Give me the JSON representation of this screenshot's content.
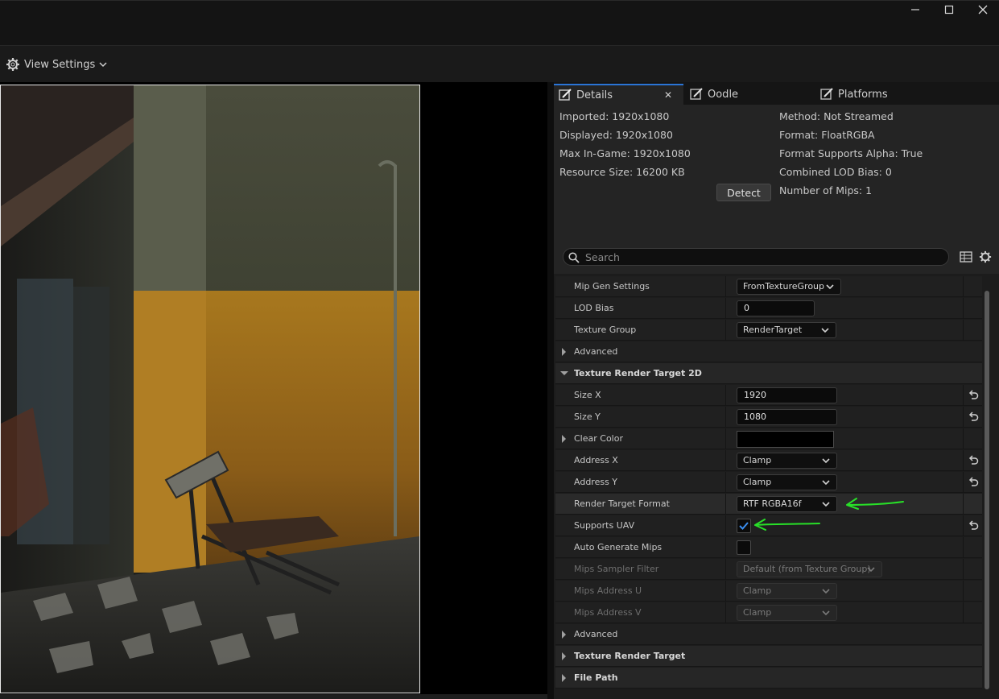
{
  "window": {
    "minimize": "—",
    "maximize": "☐",
    "close": "✕"
  },
  "toolbar": {
    "view_settings_label": "View Settings",
    "view_settings_icon": "gear-icon"
  },
  "tabs": [
    {
      "label": "Details",
      "icon": "pencil-icon",
      "active": true,
      "close": "✕"
    },
    {
      "label": "Oodle",
      "icon": "pencil-icon",
      "active": false
    },
    {
      "label": "Platforms",
      "icon": "pencil-icon",
      "active": false
    }
  ],
  "info": {
    "left": [
      "Imported: 1920x1080",
      "Displayed: 1920x1080",
      "Max In-Game: 1920x1080",
      "Resource Size: 16200 KB"
    ],
    "right": [
      "Method: Not Streamed",
      "Format: FloatRGBA",
      "Format Supports Alpha: True",
      "Combined LOD Bias: 0",
      "Number of Mips: 1"
    ],
    "detect_label": "Detect"
  },
  "search": {
    "placeholder": "Search",
    "value": ""
  },
  "properties": {
    "mip_gen_settings": {
      "label": "Mip Gen Settings",
      "value": "FromTextureGroup"
    },
    "lod_bias": {
      "label": "LOD Bias",
      "value": "0"
    },
    "texture_group": {
      "label": "Texture Group",
      "value": "RenderTarget"
    },
    "advanced_1": {
      "label": "Advanced"
    },
    "category_rt2d": {
      "label": "Texture Render Target 2D"
    },
    "size_x": {
      "label": "Size X",
      "value": "1920"
    },
    "size_y": {
      "label": "Size Y",
      "value": "1080"
    },
    "clear_color": {
      "label": "Clear Color",
      "value": "#000000"
    },
    "address_x": {
      "label": "Address X",
      "value": "Clamp"
    },
    "address_y": {
      "label": "Address Y",
      "value": "Clamp"
    },
    "render_target_format": {
      "label": "Render Target Format",
      "value": "RTF RGBA16f"
    },
    "supports_uav": {
      "label": "Supports UAV",
      "checked": true
    },
    "auto_generate_mips": {
      "label": "Auto Generate Mips",
      "checked": false
    },
    "mips_sampler_filter": {
      "label": "Mips Sampler Filter",
      "value": "Default (from Texture Group)"
    },
    "mips_address_u": {
      "label": "Mips Address U",
      "value": "Clamp"
    },
    "mips_address_v": {
      "label": "Mips Address V",
      "value": "Clamp"
    },
    "advanced_2": {
      "label": "Advanced"
    },
    "category_rt": {
      "label": "Texture Render Target"
    },
    "category_file_path": {
      "label": "File Path"
    }
  },
  "colors": {
    "accent": "#2a74d6",
    "annotation": "#28e028",
    "panel": "#242424",
    "background": "#151515"
  }
}
